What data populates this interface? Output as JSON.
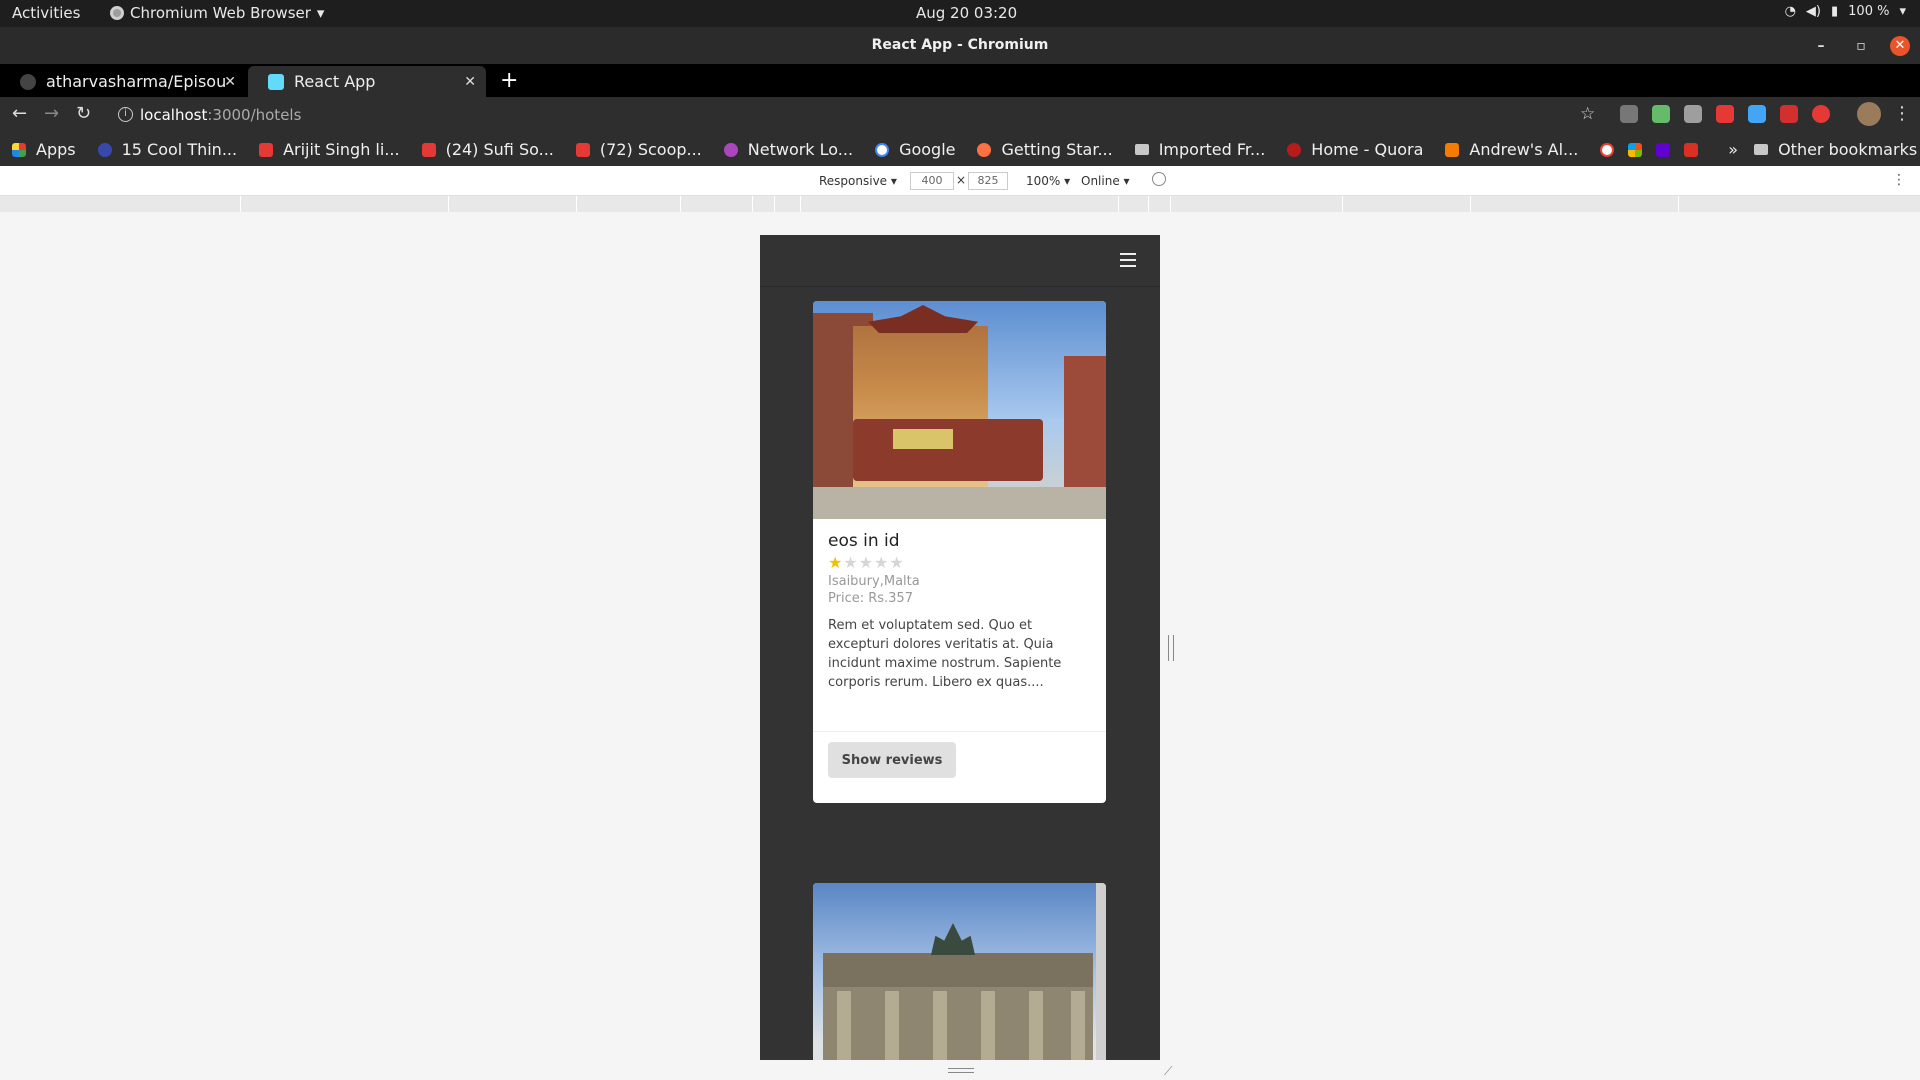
{
  "os_topbar": {
    "activities": "Activities",
    "app_menu": "Chromium Web Browser",
    "clock": "Aug 20  03:20",
    "battery": "100 %"
  },
  "window": {
    "title": "React App - Chromium"
  },
  "tabs": [
    {
      "label": "atharvasharma/Episou",
      "active": false
    },
    {
      "label": "React App",
      "active": true
    }
  ],
  "omnibox": {
    "host": "localhost",
    "path": ":3000/hotels"
  },
  "bookmarks": {
    "items": [
      {
        "label": "Apps",
        "color": "#e53935"
      },
      {
        "label": "15 Cool Thin...",
        "color": "#3949ab"
      },
      {
        "label": "Arijit Singh li...",
        "color": "#e53935"
      },
      {
        "label": "(24) Sufi So...",
        "color": "#e53935"
      },
      {
        "label": "(72) Scoop...",
        "color": "#e53935"
      },
      {
        "label": "Network Lo...",
        "color": "#ab47bc"
      },
      {
        "label": "Google",
        "color": "#ffffff"
      },
      {
        "label": "Getting Star...",
        "color": "#ff7043"
      },
      {
        "label": "Imported Fr...",
        "color": "#c8c8c8"
      },
      {
        "label": "Home - Quora",
        "color": "#b71c1c"
      },
      {
        "label": "Andrew's Al...",
        "color": "#f57c00"
      }
    ],
    "more": "»",
    "other": "Other bookmarks"
  },
  "devtools_bar": {
    "device": "Responsive",
    "width": "400",
    "height": "825",
    "zoom": "100%",
    "network": "Online"
  },
  "hotels": [
    {
      "name": "eos in id",
      "rating": 1,
      "max_rating": 5,
      "location": "Isaibury,Malta",
      "price": "Price: Rs.357",
      "description": "Rem et voluptatem sed. Quo et excepturi dolores veritatis at. Quia incidunt maxime nostrum. Sapiente corporis rerum. Libero ex quas....",
      "button_label": "Show reviews"
    }
  ],
  "icons": {
    "menu": "hamburger-icon",
    "star_filled_color": "#f2c200",
    "star_empty_color": "#d6d6d6"
  }
}
